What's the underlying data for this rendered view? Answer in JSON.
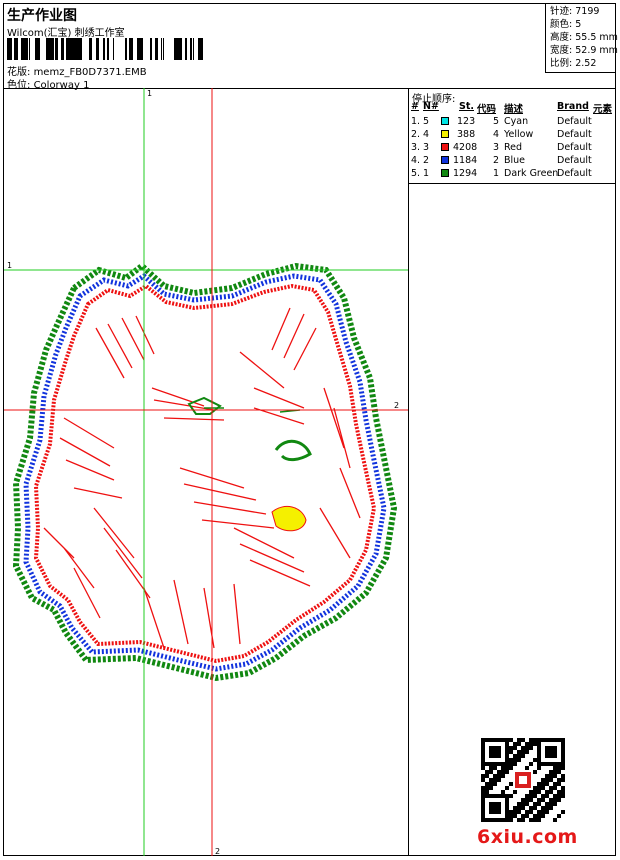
{
  "header": {
    "title": "生产作业图",
    "company": "Wilcom(汇宝) 刺绣工作室",
    "design_label": "花版:",
    "design_value": "memz_FB0D7371.EMB",
    "colorway_label": "色位:",
    "colorway_value": "Colorway 1"
  },
  "stats": [
    {
      "label": "针迹:",
      "value": "7199"
    },
    {
      "label": "颜色:",
      "value": "5"
    },
    {
      "label": "高度:",
      "value": "55.5 mm"
    },
    {
      "label": "宽度:",
      "value": "52.9 mm"
    },
    {
      "label": "比例:",
      "value": "2.52"
    }
  ],
  "stop_sequence": {
    "title": "停止顺序:",
    "headers": [
      "#",
      "N#",
      "St.",
      "代码",
      "描述",
      "Brand",
      "元素"
    ],
    "rows": [
      {
        "idx": "1.",
        "n": "5",
        "color": "#00e5e5",
        "st": "123",
        "code": "5",
        "desc": "Cyan",
        "brand": "Default"
      },
      {
        "idx": "2.",
        "n": "4",
        "color": "#f5f000",
        "st": "388",
        "code": "4",
        "desc": "Yellow",
        "brand": "Default"
      },
      {
        "idx": "3.",
        "n": "3",
        "color": "#ee1111",
        "st": "4208",
        "code": "3",
        "desc": "Red",
        "brand": "Default"
      },
      {
        "idx": "4.",
        "n": "2",
        "color": "#1133dd",
        "st": "1184",
        "code": "2",
        "desc": "Blue",
        "brand": "Default"
      },
      {
        "idx": "5.",
        "n": "1",
        "color": "#118811",
        "st": "1294",
        "code": "1",
        "desc": "Dark Green",
        "brand": "Default"
      }
    ]
  },
  "canvas": {
    "guide_v1": "1",
    "guide_h1": "1",
    "guide_h2": "2",
    "guide_v2": "2",
    "green_guide_color": "#22cc22",
    "red_guide_color": "#ee1111"
  },
  "watermark": "6xiu.com"
}
